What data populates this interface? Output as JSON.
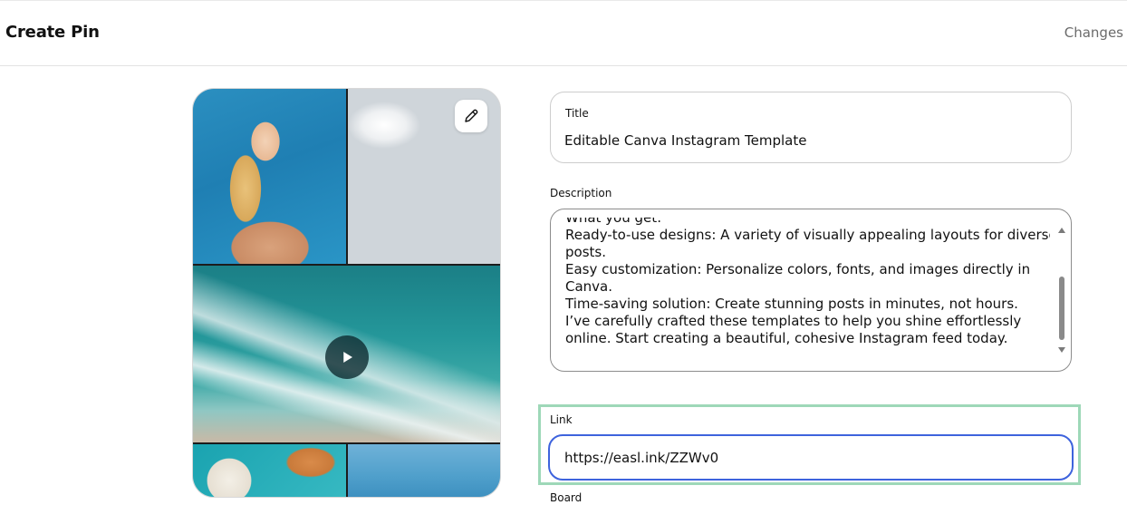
{
  "header": {
    "title": "Create Pin",
    "changes_label": "Changes"
  },
  "media": {
    "edit_icon": "pencil-icon",
    "play_icon": "play-icon"
  },
  "form": {
    "title": {
      "label": "Title",
      "value": "Editable Canva Instagram Template"
    },
    "description": {
      "label": "Description",
      "lines": [
        "What you get:",
        "Ready-to-use designs: A variety of visually appealing layouts for diverse",
        "posts.",
        "Easy customization: Personalize colors, fonts, and images directly in",
        "Canva.",
        "Time-saving solution: Create stunning posts in minutes, not hours.",
        "I’ve carefully crafted these templates to help you shine effortlessly",
        "online. Start creating a beautiful, cohesive Instagram feed today."
      ]
    },
    "link": {
      "label": "Link",
      "value": "https://easl.ink/ZZWv0"
    },
    "board": {
      "label": "Board"
    }
  },
  "colors": {
    "focus_border": "#3e63dd",
    "highlight_border": "#9ed8b8"
  }
}
